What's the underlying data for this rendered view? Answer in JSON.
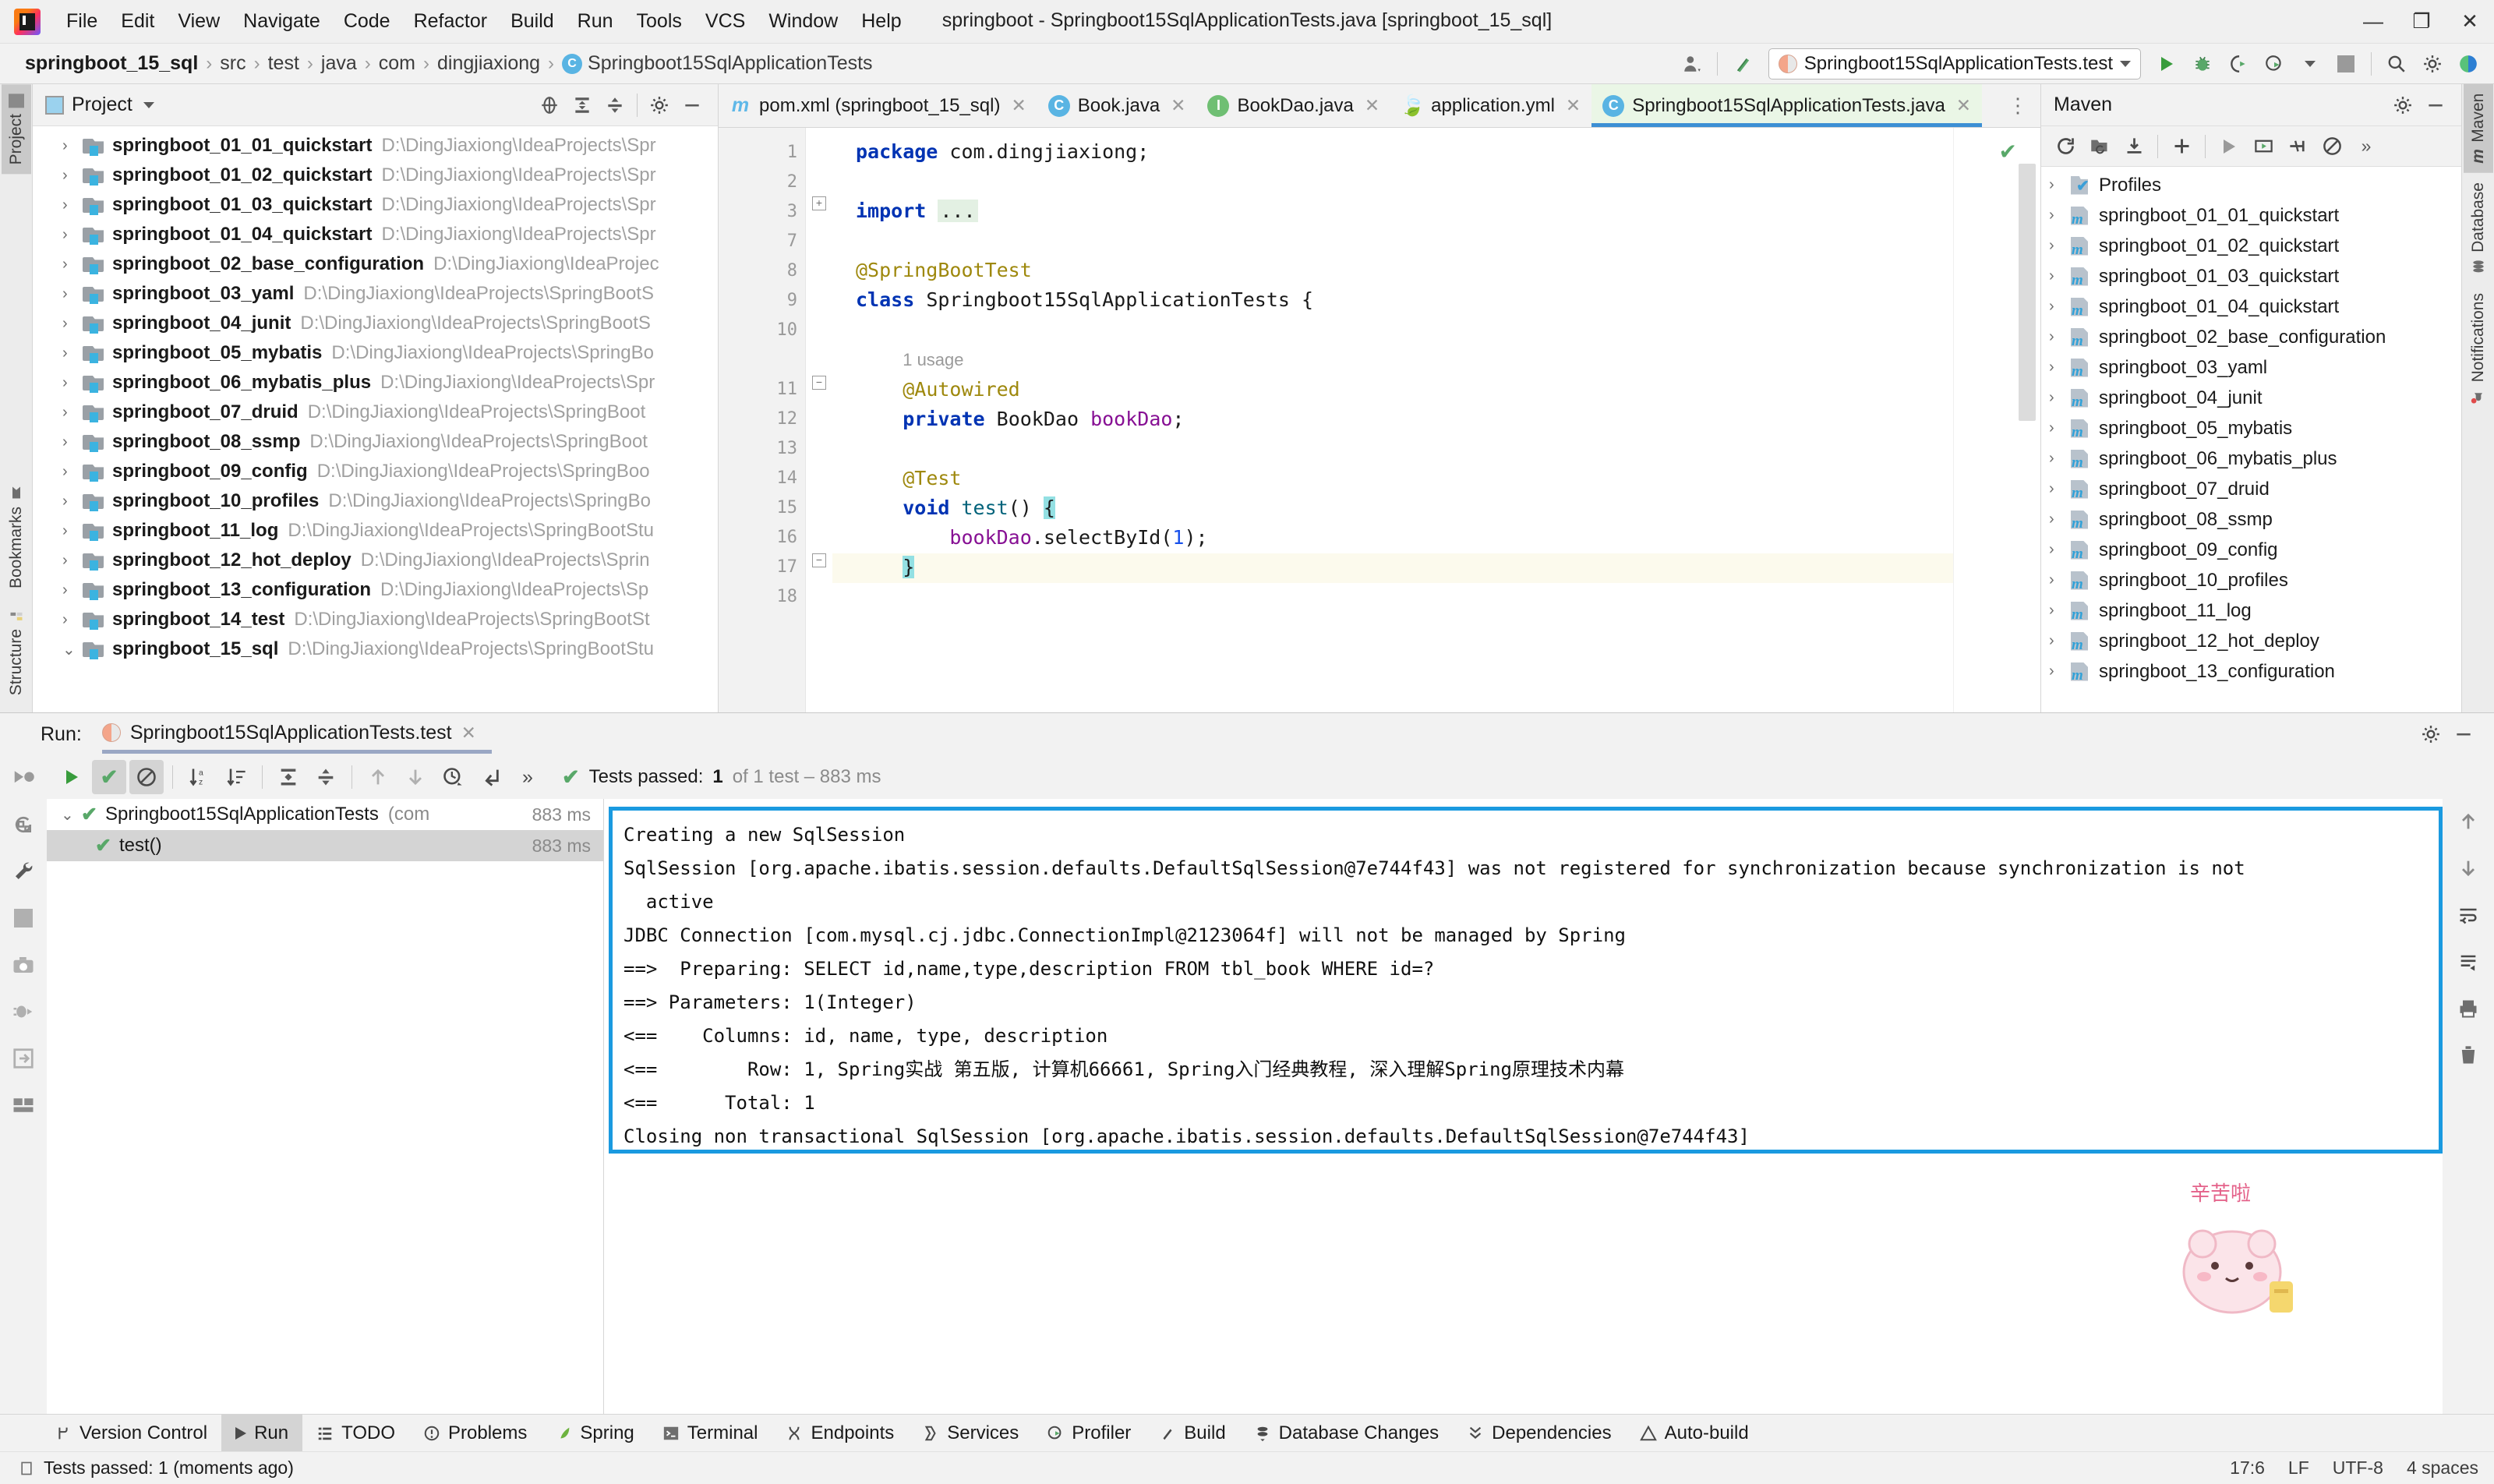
{
  "window": {
    "title": "springboot - Springboot15SqlApplicationTests.java [springboot_15_sql]",
    "minimize": "—",
    "maximize": "❐",
    "close": "✕"
  },
  "menubar": [
    {
      "label": "File"
    },
    {
      "label": "Edit"
    },
    {
      "label": "View"
    },
    {
      "label": "Navigate"
    },
    {
      "label": "Code"
    },
    {
      "label": "Refactor"
    },
    {
      "label": "Build"
    },
    {
      "label": "Run"
    },
    {
      "label": "Tools"
    },
    {
      "label": "VCS"
    },
    {
      "label": "Window"
    },
    {
      "label": "Help"
    }
  ],
  "breadcrumb": {
    "items": [
      "springboot_15_sql",
      "src",
      "test",
      "java",
      "com",
      "dingjiaxiong",
      "Springboot15SqlApplicationTests"
    ],
    "class_icon": "C",
    "separator": "›"
  },
  "navbar_right": {
    "run_config": "Springboot15SqlApplicationTests.test",
    "icons": [
      "user-icon",
      "build-hammer-icon",
      "run-icon",
      "debug-icon",
      "run-coverage-icon",
      "profile-icon",
      "stop-icon",
      "search-icon",
      "settings-icon"
    ]
  },
  "left_strip": {
    "top": [
      {
        "label": "Project",
        "active": true
      }
    ],
    "bottom": [
      {
        "label": "Bookmarks"
      },
      {
        "label": "Structure"
      }
    ]
  },
  "right_strip": [
    {
      "label": "Maven",
      "active": true
    },
    {
      "label": "Database",
      "active": false
    },
    {
      "label": "Notifications",
      "active": false
    }
  ],
  "project_panel": {
    "title": "Project",
    "toolbar_icons": [
      "select-opened-file-icon",
      "expand-all-icon",
      "collapse-all-icon",
      "gear-icon",
      "hide-icon"
    ],
    "items": [
      {
        "name": "springboot_01_01_quickstart",
        "path": "D:\\DingJiaxiong\\IdeaProjects\\Spr",
        "expanded": false
      },
      {
        "name": "springboot_01_02_quickstart",
        "path": "D:\\DingJiaxiong\\IdeaProjects\\Spr",
        "expanded": false
      },
      {
        "name": "springboot_01_03_quickstart",
        "path": "D:\\DingJiaxiong\\IdeaProjects\\Spr",
        "expanded": false
      },
      {
        "name": "springboot_01_04_quickstart",
        "path": "D:\\DingJiaxiong\\IdeaProjects\\Spr",
        "expanded": false
      },
      {
        "name": "springboot_02_base_configuration",
        "path": "D:\\DingJiaxiong\\IdeaProjec",
        "expanded": false
      },
      {
        "name": "springboot_03_yaml",
        "path": "D:\\DingJiaxiong\\IdeaProjects\\SpringBootS",
        "expanded": false
      },
      {
        "name": "springboot_04_junit",
        "path": "D:\\DingJiaxiong\\IdeaProjects\\SpringBootS",
        "expanded": false
      },
      {
        "name": "springboot_05_mybatis",
        "path": "D:\\DingJiaxiong\\IdeaProjects\\SpringBo",
        "expanded": false
      },
      {
        "name": "springboot_06_mybatis_plus",
        "path": "D:\\DingJiaxiong\\IdeaProjects\\Spr",
        "expanded": false
      },
      {
        "name": "springboot_07_druid",
        "path": "D:\\DingJiaxiong\\IdeaProjects\\SpringBoot",
        "expanded": false
      },
      {
        "name": "springboot_08_ssmp",
        "path": "D:\\DingJiaxiong\\IdeaProjects\\SpringBoot",
        "expanded": false
      },
      {
        "name": "springboot_09_config",
        "path": "D:\\DingJiaxiong\\IdeaProjects\\SpringBoo",
        "expanded": false
      },
      {
        "name": "springboot_10_profiles",
        "path": "D:\\DingJiaxiong\\IdeaProjects\\SpringBo",
        "expanded": false
      },
      {
        "name": "springboot_11_log",
        "path": "D:\\DingJiaxiong\\IdeaProjects\\SpringBootStu",
        "expanded": false
      },
      {
        "name": "springboot_12_hot_deploy",
        "path": "D:\\DingJiaxiong\\IdeaProjects\\Sprin",
        "expanded": false
      },
      {
        "name": "springboot_13_configuration",
        "path": "D:\\DingJiaxiong\\IdeaProjects\\Sp",
        "expanded": false
      },
      {
        "name": "springboot_14_test",
        "path": "D:\\DingJiaxiong\\IdeaProjects\\SpringBootSt",
        "expanded": false
      },
      {
        "name": "springboot_15_sql",
        "path": "D:\\DingJiaxiong\\IdeaProjects\\SpringBootStu",
        "expanded": true
      }
    ]
  },
  "editor_tabs": [
    {
      "label": "pom.xml (springboot_15_sql)",
      "icon": "maven-file-icon",
      "active": false
    },
    {
      "label": "Book.java",
      "icon": "class-icon",
      "active": false
    },
    {
      "label": "BookDao.java",
      "icon": "interface-icon",
      "active": false
    },
    {
      "label": "application.yml",
      "icon": "spring-yaml-icon",
      "active": false
    },
    {
      "label": "Springboot15SqlApplicationTests.java",
      "icon": "test-class-icon",
      "active": true
    }
  ],
  "editor": {
    "lines": [
      {
        "num": "1",
        "marker": "",
        "text": "package com.dingjiaxiong;"
      },
      {
        "num": "2",
        "marker": "",
        "text": ""
      },
      {
        "num": "3",
        "marker": "",
        "text": "import ..."
      },
      {
        "num": "7",
        "marker": "",
        "text": ""
      },
      {
        "num": "8",
        "marker": "spring-leaf-icon",
        "text": "@SpringBootTest"
      },
      {
        "num": "9",
        "marker": "run-test-icon",
        "text": "class Springboot15SqlApplicationTests {"
      },
      {
        "num": "10",
        "marker": "",
        "text": ""
      },
      {
        "num": "",
        "marker": "",
        "text": "1 usage"
      },
      {
        "num": "11",
        "marker": "",
        "text": "@Autowired"
      },
      {
        "num": "12",
        "marker": "bean-icon",
        "text": "private BookDao bookDao;"
      },
      {
        "num": "13",
        "marker": "",
        "text": ""
      },
      {
        "num": "14",
        "marker": "",
        "text": "@Test"
      },
      {
        "num": "15",
        "marker": "run-test-icon",
        "text": "void test() {"
      },
      {
        "num": "16",
        "marker": "",
        "text": "bookDao.selectById(1);"
      },
      {
        "num": "17",
        "marker": "",
        "text": "}"
      },
      {
        "num": "18",
        "marker": "",
        "text": ""
      }
    ],
    "usage_hint": "1 usage",
    "inspection_status": "✔"
  },
  "maven_panel": {
    "title": "Maven",
    "toolbar_icons": [
      "reload-icon",
      "add-folder-icon",
      "download-sources-icon",
      "add-icon",
      "run-icon",
      "execute-goal-icon",
      "skip-tests-icon",
      "toggle-offline-icon",
      "more-icon"
    ],
    "items": [
      {
        "name": "Profiles",
        "type": "profiles"
      },
      {
        "name": "springboot_01_01_quickstart",
        "type": "module"
      },
      {
        "name": "springboot_01_02_quickstart",
        "type": "module"
      },
      {
        "name": "springboot_01_03_quickstart",
        "type": "module"
      },
      {
        "name": "springboot_01_04_quickstart",
        "type": "module"
      },
      {
        "name": "springboot_02_base_configuration",
        "type": "module"
      },
      {
        "name": "springboot_03_yaml",
        "type": "module"
      },
      {
        "name": "springboot_04_junit",
        "type": "module"
      },
      {
        "name": "springboot_05_mybatis",
        "type": "module"
      },
      {
        "name": "springboot_06_mybatis_plus",
        "type": "module"
      },
      {
        "name": "springboot_07_druid",
        "type": "module"
      },
      {
        "name": "springboot_08_ssmp",
        "type": "module"
      },
      {
        "name": "springboot_09_config",
        "type": "module"
      },
      {
        "name": "springboot_10_profiles",
        "type": "module"
      },
      {
        "name": "springboot_11_log",
        "type": "module"
      },
      {
        "name": "springboot_12_hot_deploy",
        "type": "module"
      },
      {
        "name": "springboot_13_configuration",
        "type": "module"
      }
    ]
  },
  "run_panel": {
    "label": "Run:",
    "tab_title": "Springboot15SqlApplicationTests.test",
    "close": "✕",
    "toolbar_icons": [
      "rerun-icon",
      "show-passed-icon",
      "show-ignored-icon",
      "sort-alphabetically-icon",
      "sort-by-duration-icon",
      "expand-all-icon",
      "collapse-all-icon",
      "prev-failed-icon",
      "next-failed-icon",
      "history-icon",
      "import-tests-icon",
      "more-icon"
    ],
    "status": {
      "prefix": "Tests passed:",
      "count": "1",
      "suffix": "of 1 test – 883 ms"
    },
    "tree": [
      {
        "name": "Springboot15SqlApplicationTests",
        "pkg": "(com",
        "time": "883 ms",
        "level": 0,
        "selected": false
      },
      {
        "name": "test()",
        "pkg": "",
        "time": "883 ms",
        "level": 1,
        "selected": true
      }
    ],
    "left_icons": [
      "rerun-failed-icon",
      "rerun-automatically-icon",
      "settings-wrench-icon",
      "stop-icon",
      "screenshot-icon",
      "debug-icon",
      "export-icon",
      "layout-icon"
    ],
    "right_icons": [
      "scroll-up-icon",
      "scroll-down-icon",
      "soft-wrap-icon",
      "scroll-to-end-icon",
      "print-icon",
      "trash-icon"
    ],
    "console_lines": [
      "Creating a new SqlSession",
      "SqlSession [org.apache.ibatis.session.defaults.DefaultSqlSession@7e744f43] was not registered for synchronization because synchronization is not",
      "  active",
      "JDBC Connection [com.mysql.cj.jdbc.ConnectionImpl@2123064f] will not be managed by Spring",
      "==>  Preparing: SELECT id,name,type,description FROM tbl_book WHERE id=?",
      "==> Parameters: 1(Integer)",
      "<==    Columns: id, name, type, description",
      "<==        Row: 1, Spring实战 第五版, 计算机66661, Spring入门经典教程, 深入理解Spring原理技术内幕",
      "<==      Total: 1",
      "Closing non transactional SqlSession [org.apache.ibatis.session.defaults.DefaultSqlSession@7e744f43]"
    ]
  },
  "toolwindow_bar": [
    {
      "label": "Version Control",
      "icon": "branch-icon",
      "active": false
    },
    {
      "label": "Run",
      "icon": "run-icon",
      "active": true
    },
    {
      "label": "TODO",
      "icon": "todo-icon",
      "active": false
    },
    {
      "label": "Problems",
      "icon": "problems-icon",
      "active": false
    },
    {
      "label": "Spring",
      "icon": "spring-leaf-icon",
      "active": false
    },
    {
      "label": "Terminal",
      "icon": "terminal-icon",
      "active": false
    },
    {
      "label": "Endpoints",
      "icon": "endpoints-icon",
      "active": false
    },
    {
      "label": "Services",
      "icon": "services-icon",
      "active": false
    },
    {
      "label": "Profiler",
      "icon": "profiler-icon",
      "active": false
    },
    {
      "label": "Build",
      "icon": "build-icon",
      "active": false
    },
    {
      "label": "Database Changes",
      "icon": "database-changes-icon",
      "active": false
    },
    {
      "label": "Dependencies",
      "icon": "dependencies-icon",
      "active": false
    },
    {
      "label": "Auto-build",
      "icon": "auto-build-icon",
      "active": false
    }
  ],
  "statusbar": {
    "message": "Tests passed: 1 (moments ago)",
    "caret": "17:6",
    "line_sep": "LF",
    "encoding": "UTF-8",
    "indent": "4 spaces"
  },
  "colors": {
    "accent_blue": "#1a9ae0",
    "pass_green": "#59a869",
    "keyword_blue": "#0033b3",
    "annotation_gold": "#9e880d",
    "field_purple": "#871094",
    "active_tab_green": "#eaf6e6"
  }
}
